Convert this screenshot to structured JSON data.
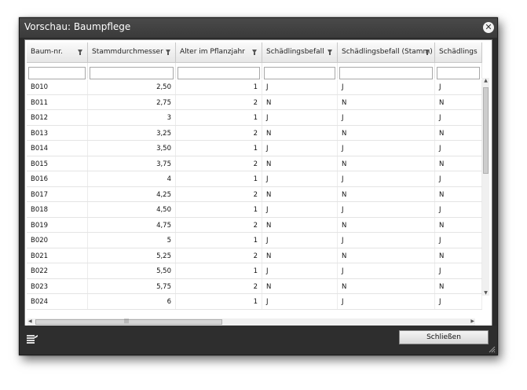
{
  "window": {
    "title": "Vorschau: Baumpflege",
    "close_glyph": "✕"
  },
  "grid": {
    "columns": [
      {
        "label": "Baum-nr."
      },
      {
        "label": "Stammdurchmesser"
      },
      {
        "label": "Alter im Pflanzjahr"
      },
      {
        "label": "Schädlingsbefall"
      },
      {
        "label": "Schädlingsbefall (Stamm)"
      },
      {
        "label": "Schädlings"
      }
    ],
    "rows": [
      [
        "B010",
        "2,50",
        "1",
        "J",
        "J",
        "J"
      ],
      [
        "B011",
        "2,75",
        "2",
        "N",
        "N",
        "N"
      ],
      [
        "B012",
        "3",
        "1",
        "J",
        "J",
        "J"
      ],
      [
        "B013",
        "3,25",
        "2",
        "N",
        "N",
        "N"
      ],
      [
        "B014",
        "3,50",
        "1",
        "J",
        "J",
        "J"
      ],
      [
        "B015",
        "3,75",
        "2",
        "N",
        "N",
        "N"
      ],
      [
        "B016",
        "4",
        "1",
        "J",
        "J",
        "J"
      ],
      [
        "B017",
        "4,25",
        "2",
        "N",
        "N",
        "N"
      ],
      [
        "B018",
        "4,50",
        "1",
        "J",
        "J",
        "J"
      ],
      [
        "B019",
        "4,75",
        "2",
        "N",
        "N",
        "N"
      ],
      [
        "B020",
        "5",
        "1",
        "J",
        "J",
        "J"
      ],
      [
        "B021",
        "5,25",
        "2",
        "N",
        "N",
        "N"
      ],
      [
        "B022",
        "5,50",
        "1",
        "J",
        "J",
        "J"
      ],
      [
        "B023",
        "5,75",
        "2",
        "N",
        "N",
        "N"
      ],
      [
        "B024",
        "6",
        "1",
        "J",
        "J",
        "J"
      ]
    ],
    "hscroll_center_glyph": "|||"
  },
  "footer": {
    "close_label": "Schließen",
    "export_icon": "export-icon"
  },
  "colors": {
    "window_bg": "#2b2b2b",
    "grid_bg": "#ffffff",
    "header_bg": "#e6e6e6"
  }
}
